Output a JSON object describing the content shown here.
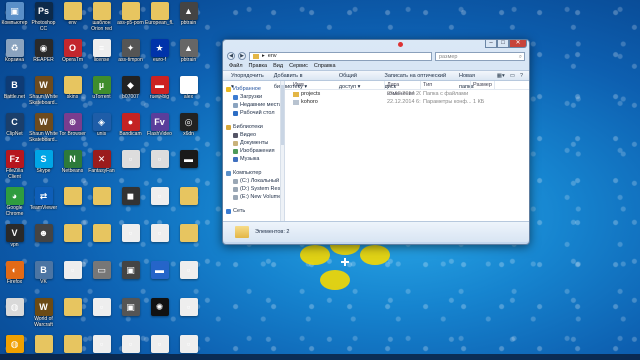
{
  "desktop": {
    "icons": [
      {
        "label": "Компьютер",
        "color": "#5a8fc8",
        "glyph": "▣"
      },
      {
        "label": "Photoshop CC",
        "color": "#0d2a4a",
        "glyph": "Ps"
      },
      {
        "label": "env",
        "color": "#e7c560",
        "glyph": ""
      },
      {
        "label": "шаблон Orion red",
        "color": "#e7c560",
        "glyph": ""
      },
      {
        "label": "ass-p5-porn",
        "color": "#e7c560",
        "glyph": ""
      },
      {
        "label": "European_fl...",
        "color": "#e7c560",
        "glyph": ""
      },
      {
        "label": "pbtrain",
        "color": "#444444",
        "glyph": "▲"
      },
      {
        "label": "Корзина",
        "color": "#8aa3bf",
        "glyph": "♻"
      },
      {
        "label": "REAPER",
        "color": "#2a2a2a",
        "glyph": "◉"
      },
      {
        "label": "OperaTm",
        "color": "#c3272d",
        "glyph": "O"
      },
      {
        "label": "license",
        "color": "#eeeeee",
        "glyph": "≡"
      },
      {
        "label": "ass-timpon",
        "color": "#555555",
        "glyph": "✦"
      },
      {
        "label": "euro-f",
        "color": "#0033aa",
        "glyph": "★"
      },
      {
        "label": "pbtrain",
        "color": "#666666",
        "glyph": "▲"
      },
      {
        "label": "Battle.net",
        "color": "#0e3b75",
        "glyph": "B"
      },
      {
        "label": "Shaun White Skateboard...",
        "color": "#6d4b1e",
        "glyph": "W"
      },
      {
        "label": "skins",
        "color": "#e7c560",
        "glyph": ""
      },
      {
        "label": "uTorrent",
        "color": "#3f8d2d",
        "glyph": "µ"
      },
      {
        "label": "b07007",
        "color": "#222222",
        "glyph": "◆"
      },
      {
        "label": "ruew-big",
        "color": "#cc2222",
        "glyph": "▬"
      },
      {
        "label": "alex",
        "color": "#ffffff",
        "glyph": "☺"
      },
      {
        "label": "ClipNet",
        "color": "#1b3f6b",
        "glyph": "C"
      },
      {
        "label": "Shaun White Skateboard...",
        "color": "#6d4b1e",
        "glyph": "W"
      },
      {
        "label": "Tor Browser",
        "color": "#7a3d8e",
        "glyph": "⊕"
      },
      {
        "label": "unis",
        "color": "#1e5da8",
        "glyph": "◈"
      },
      {
        "label": "Bandicam",
        "color": "#c42323",
        "glyph": "●"
      },
      {
        "label": "FlashVideo",
        "color": "#5a3e9b",
        "glyph": "Fv"
      },
      {
        "label": "x6dn",
        "color": "#222222",
        "glyph": "◎"
      },
      {
        "label": "FileZilla Client",
        "color": "#b6171e",
        "glyph": "Fz"
      },
      {
        "label": "Skype",
        "color": "#00a6e6",
        "glyph": "S"
      },
      {
        "label": "Netbeans",
        "color": "#2d7a3a",
        "glyph": "N"
      },
      {
        "label": "FantasyFan",
        "color": "#9b1c1c",
        "glyph": "✕"
      },
      {
        "label": "",
        "color": "#dddddd",
        "glyph": "▫"
      },
      {
        "label": "",
        "color": "#dddddd",
        "glyph": "▫"
      },
      {
        "label": "",
        "color": "#1a1a1a",
        "glyph": "▬"
      },
      {
        "label": "Google Chrome",
        "color": "#2f9c3f",
        "glyph": "◕"
      },
      {
        "label": "TeamViewer",
        "color": "#0e5eb8",
        "glyph": "⇄"
      },
      {
        "label": "",
        "color": "#e7c560",
        "glyph": ""
      },
      {
        "label": "",
        "color": "#e7c560",
        "glyph": ""
      },
      {
        "label": "",
        "color": "#333333",
        "glyph": "◼"
      },
      {
        "label": "",
        "color": "#eeeeee",
        "glyph": "▫"
      },
      {
        "label": "",
        "color": "#e7c560",
        "glyph": ""
      },
      {
        "label": "vpn",
        "color": "#2a2a2a",
        "glyph": "V"
      },
      {
        "label": "",
        "color": "#444444",
        "glyph": "☻"
      },
      {
        "label": "",
        "color": "#e7c560",
        "glyph": ""
      },
      {
        "label": "",
        "color": "#e7c560",
        "glyph": ""
      },
      {
        "label": "",
        "color": "#eeeeee",
        "glyph": "▫"
      },
      {
        "label": "",
        "color": "#eeeeee",
        "glyph": "▫"
      },
      {
        "label": "",
        "color": "#e7c560",
        "glyph": ""
      },
      {
        "label": "Firefox",
        "color": "#e26a16",
        "glyph": "◐"
      },
      {
        "label": "VK",
        "color": "#4c75a3",
        "glyph": "B"
      },
      {
        "label": "",
        "color": "#eeeeee",
        "glyph": "▫"
      },
      {
        "label": "",
        "color": "#777777",
        "glyph": "▭"
      },
      {
        "label": "",
        "color": "#444444",
        "glyph": "▣"
      },
      {
        "label": "",
        "color": "#2565c9",
        "glyph": "▬"
      },
      {
        "label": "",
        "color": "#eeeeee",
        "glyph": "▫"
      },
      {
        "label": "",
        "color": "#d9d9d9",
        "glyph": "◍"
      },
      {
        "label": "World of Warcraft",
        "color": "#6b4a14",
        "glyph": "W"
      },
      {
        "label": "",
        "color": "#e7c560",
        "glyph": ""
      },
      {
        "label": "",
        "color": "#eeeeee",
        "glyph": "▫"
      },
      {
        "label": "",
        "color": "#555555",
        "glyph": "▣"
      },
      {
        "label": "",
        "color": "#111111",
        "glyph": "✺"
      },
      {
        "label": "",
        "color": "#eeeeee",
        "glyph": "▫"
      },
      {
        "label": "",
        "color": "#f0a000",
        "glyph": "◍"
      },
      {
        "label": "",
        "color": "#e7c560",
        "glyph": ""
      },
      {
        "label": "",
        "color": "#e7c560",
        "glyph": ""
      },
      {
        "label": "",
        "color": "#eeeeee",
        "glyph": "▫"
      },
      {
        "label": "",
        "color": "#eeeeee",
        "glyph": "▫"
      },
      {
        "label": "",
        "color": "#eeeeee",
        "glyph": "▫"
      },
      {
        "label": "",
        "color": "#eeeeee",
        "glyph": "▫"
      }
    ]
  },
  "explorer": {
    "address": "env",
    "search_placeholder": "размер",
    "menu": [
      "Файл",
      "Правка",
      "Вид",
      "Сервис",
      "Справка"
    ],
    "toolbar": [
      "Упорядочить ▾",
      "Добавить в библиотеку ▾",
      "Общий доступ ▾",
      "Записать на оптический диск",
      "Новая папка"
    ],
    "nav": {
      "favorites_header": "Избранное",
      "favorites": [
        "Загрузки",
        "Недавние места",
        "Рабочий стол"
      ],
      "libraries_header": "Библиотеки",
      "libraries": [
        "Видео",
        "Документы",
        "Изображения",
        "Музыка"
      ],
      "computer_header": "Компьютер",
      "drives": [
        "(C:) Локальный",
        "(D:) System Rese",
        "(E:) New Volume"
      ],
      "network_header": "Сеть"
    },
    "columns": [
      "Имя",
      "Дата изменения",
      "Тип",
      "Размер"
    ],
    "files": [
      {
        "name": "projects",
        "date": "25.12.2014 20:05",
        "type": "Папка с файлами",
        "size": "",
        "kind": "folder"
      },
      {
        "name": "kohoro",
        "date": "22.12.2014 6:32",
        "type": "Параметры конф...",
        "size": "1 КБ",
        "kind": "file"
      }
    ],
    "status": "Элементов: 2"
  }
}
